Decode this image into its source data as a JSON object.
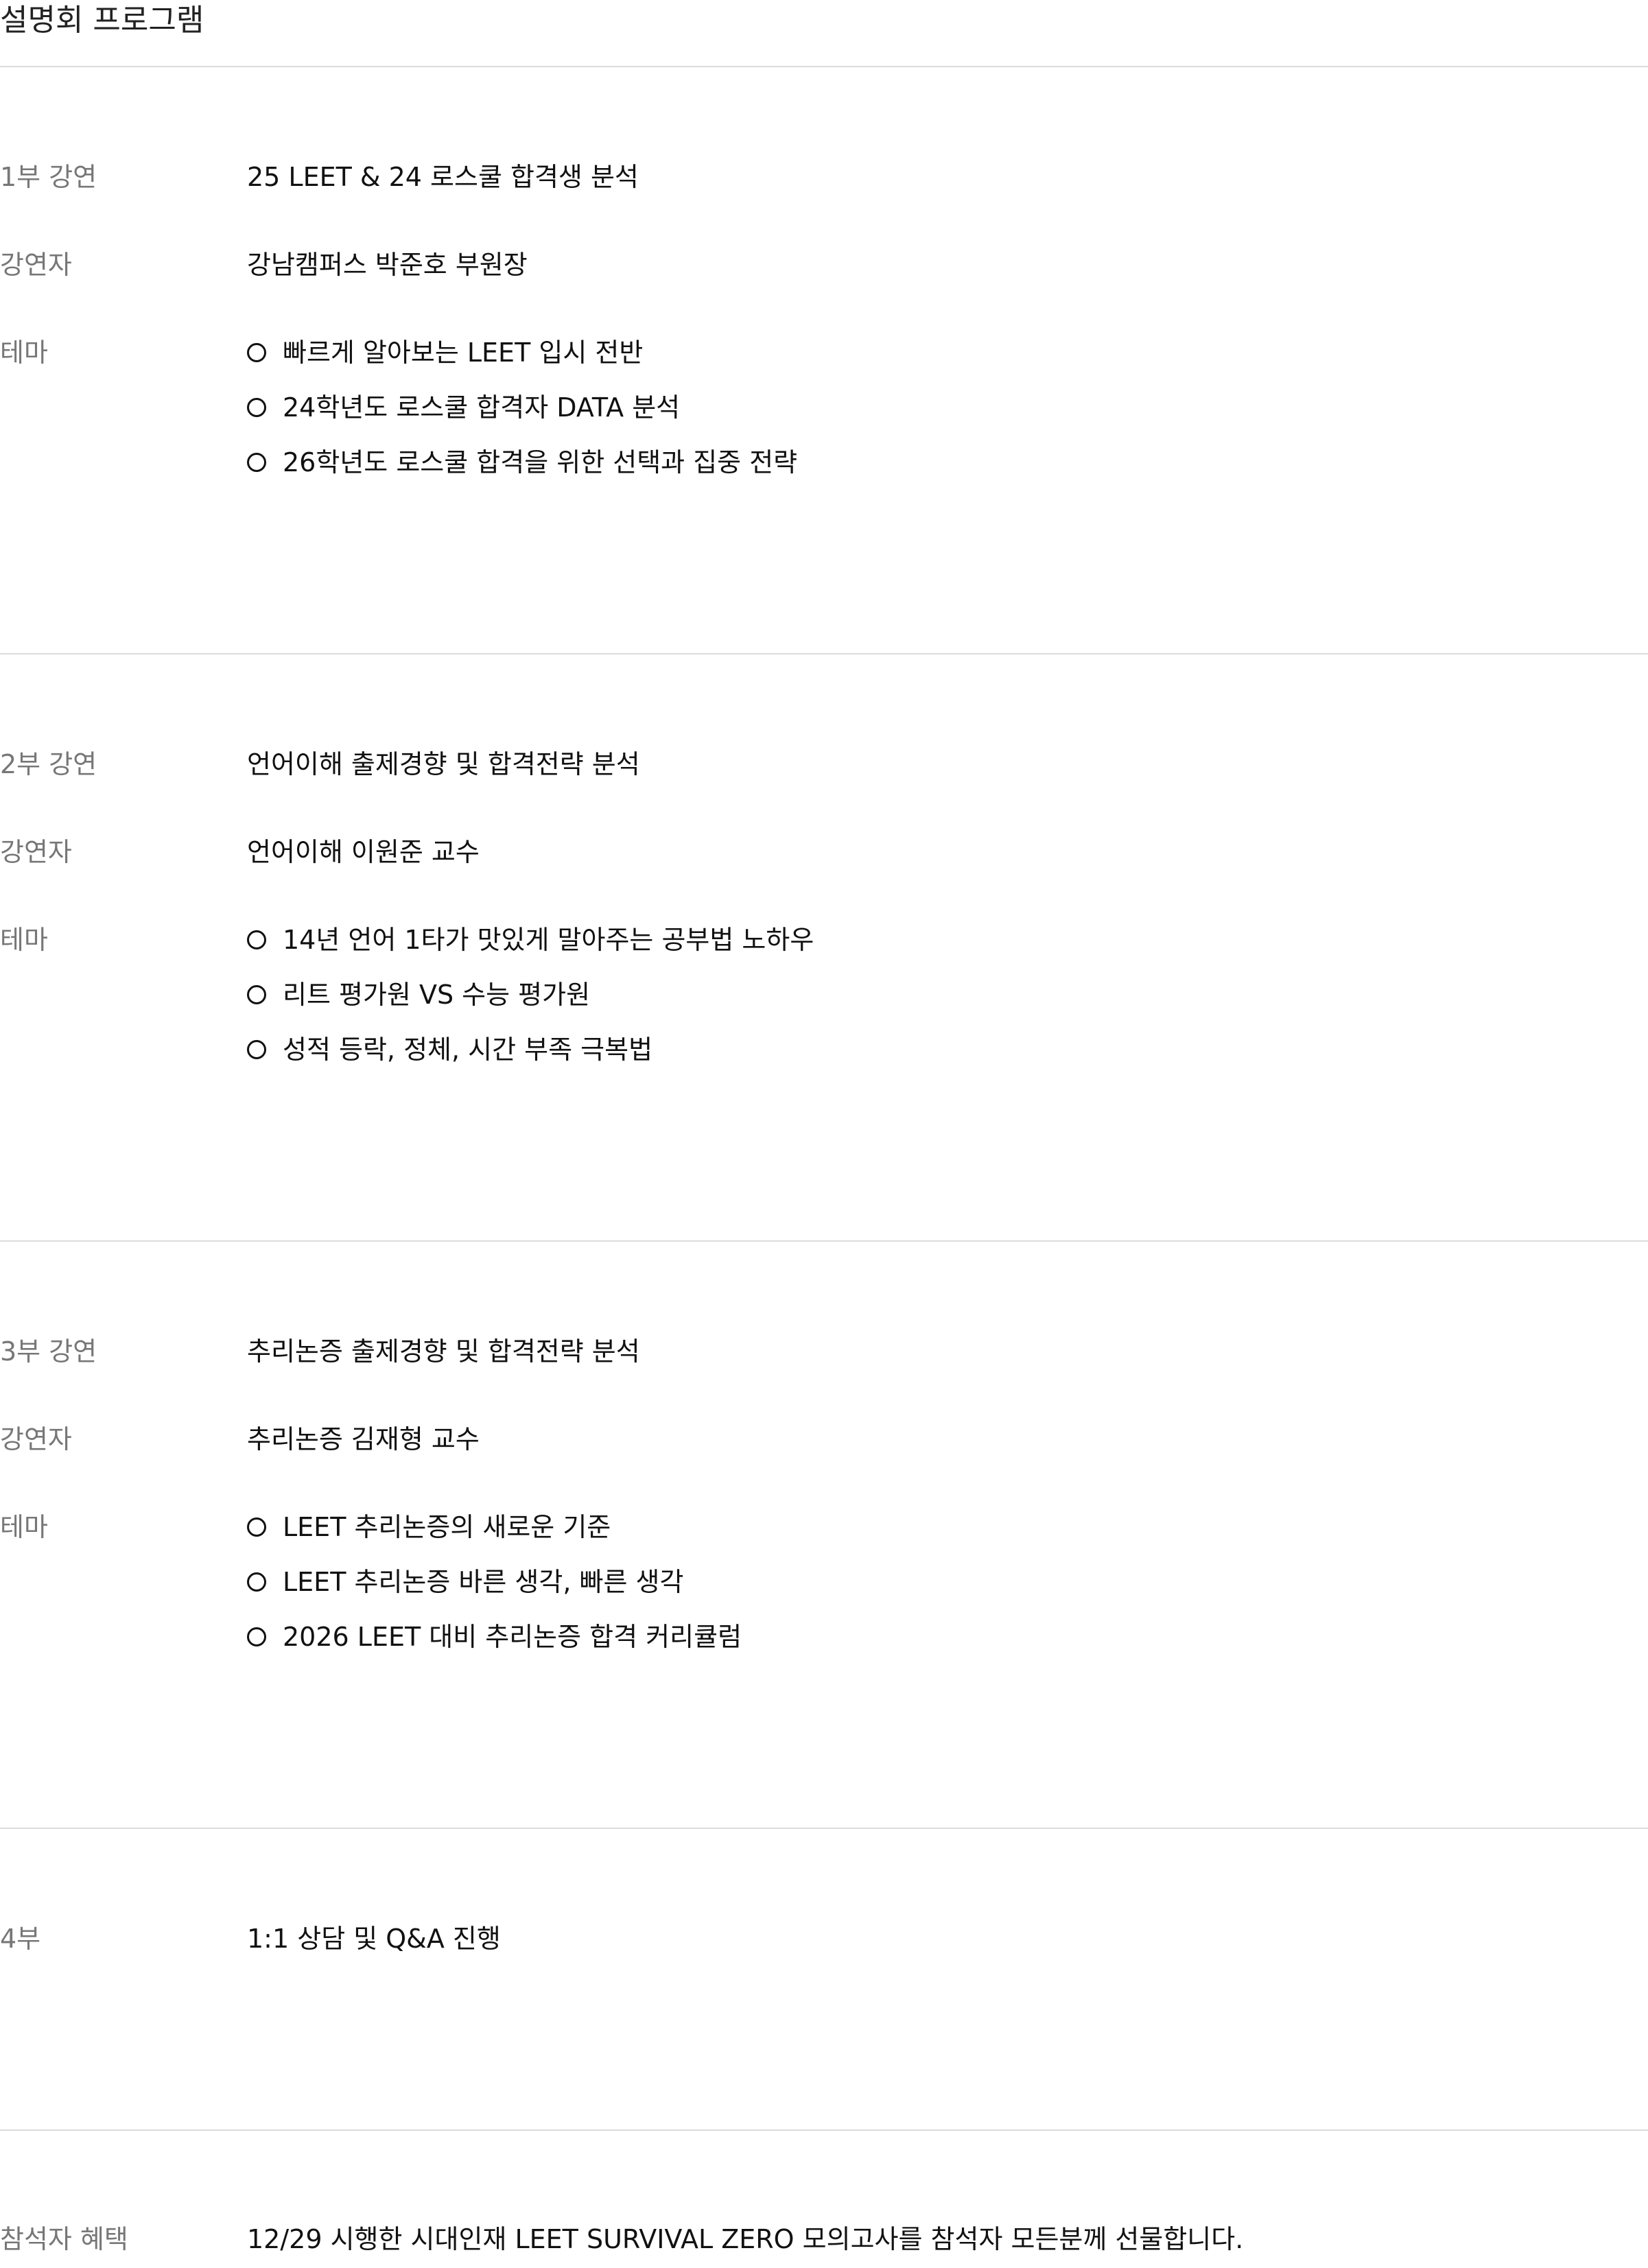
{
  "page_title": "설명회 프로그램",
  "sections": [
    {
      "rows": [
        {
          "label": "1부 강연",
          "value": "25 LEET & 24 로스쿨 합격생 분석"
        },
        {
          "label": "강연자",
          "value": "강남캠퍼스 박준호 부원장"
        },
        {
          "label": "테마",
          "items": [
            "빠르게 알아보는 LEET 입시 전반",
            "24학년도 로스쿨 합격자 DATA 분석",
            "26학년도 로스쿨 합격을 위한 선택과 집중 전략"
          ]
        }
      ]
    },
    {
      "rows": [
        {
          "label": "2부 강연",
          "value": "언어이해 출제경향 및 합격전략 분석"
        },
        {
          "label": "강연자",
          "value": "언어이해 이원준 교수"
        },
        {
          "label": "테마",
          "items": [
            "14년 언어 1타가 맛있게 말아주는 공부법 노하우",
            "리트 평가원 VS 수능 평가원",
            "성적 등락, 정체, 시간 부족 극복법"
          ]
        }
      ]
    },
    {
      "rows": [
        {
          "label": "3부 강연",
          "value": "추리논증 출제경향 및 합격전략 분석"
        },
        {
          "label": "강연자",
          "value": "추리논증 김재형 교수"
        },
        {
          "label": "테마",
          "items": [
            "LEET 추리논증의 새로운 기준",
            "LEET 추리논증 바른 생각, 빠른 생각",
            "2026 LEET 대비 추리논증 합격 커리큘럼"
          ]
        }
      ]
    },
    {
      "rows": [
        {
          "label": "4부",
          "value": "1:1 상담 및 Q&A 진행"
        }
      ]
    },
    {
      "rows": [
        {
          "label": "참석자 혜택",
          "value": "12/29 시행한 시대인재 LEET SURVIVAL ZERO 모의고사를 참석자 모든분께 선물합니다."
        }
      ]
    }
  ]
}
